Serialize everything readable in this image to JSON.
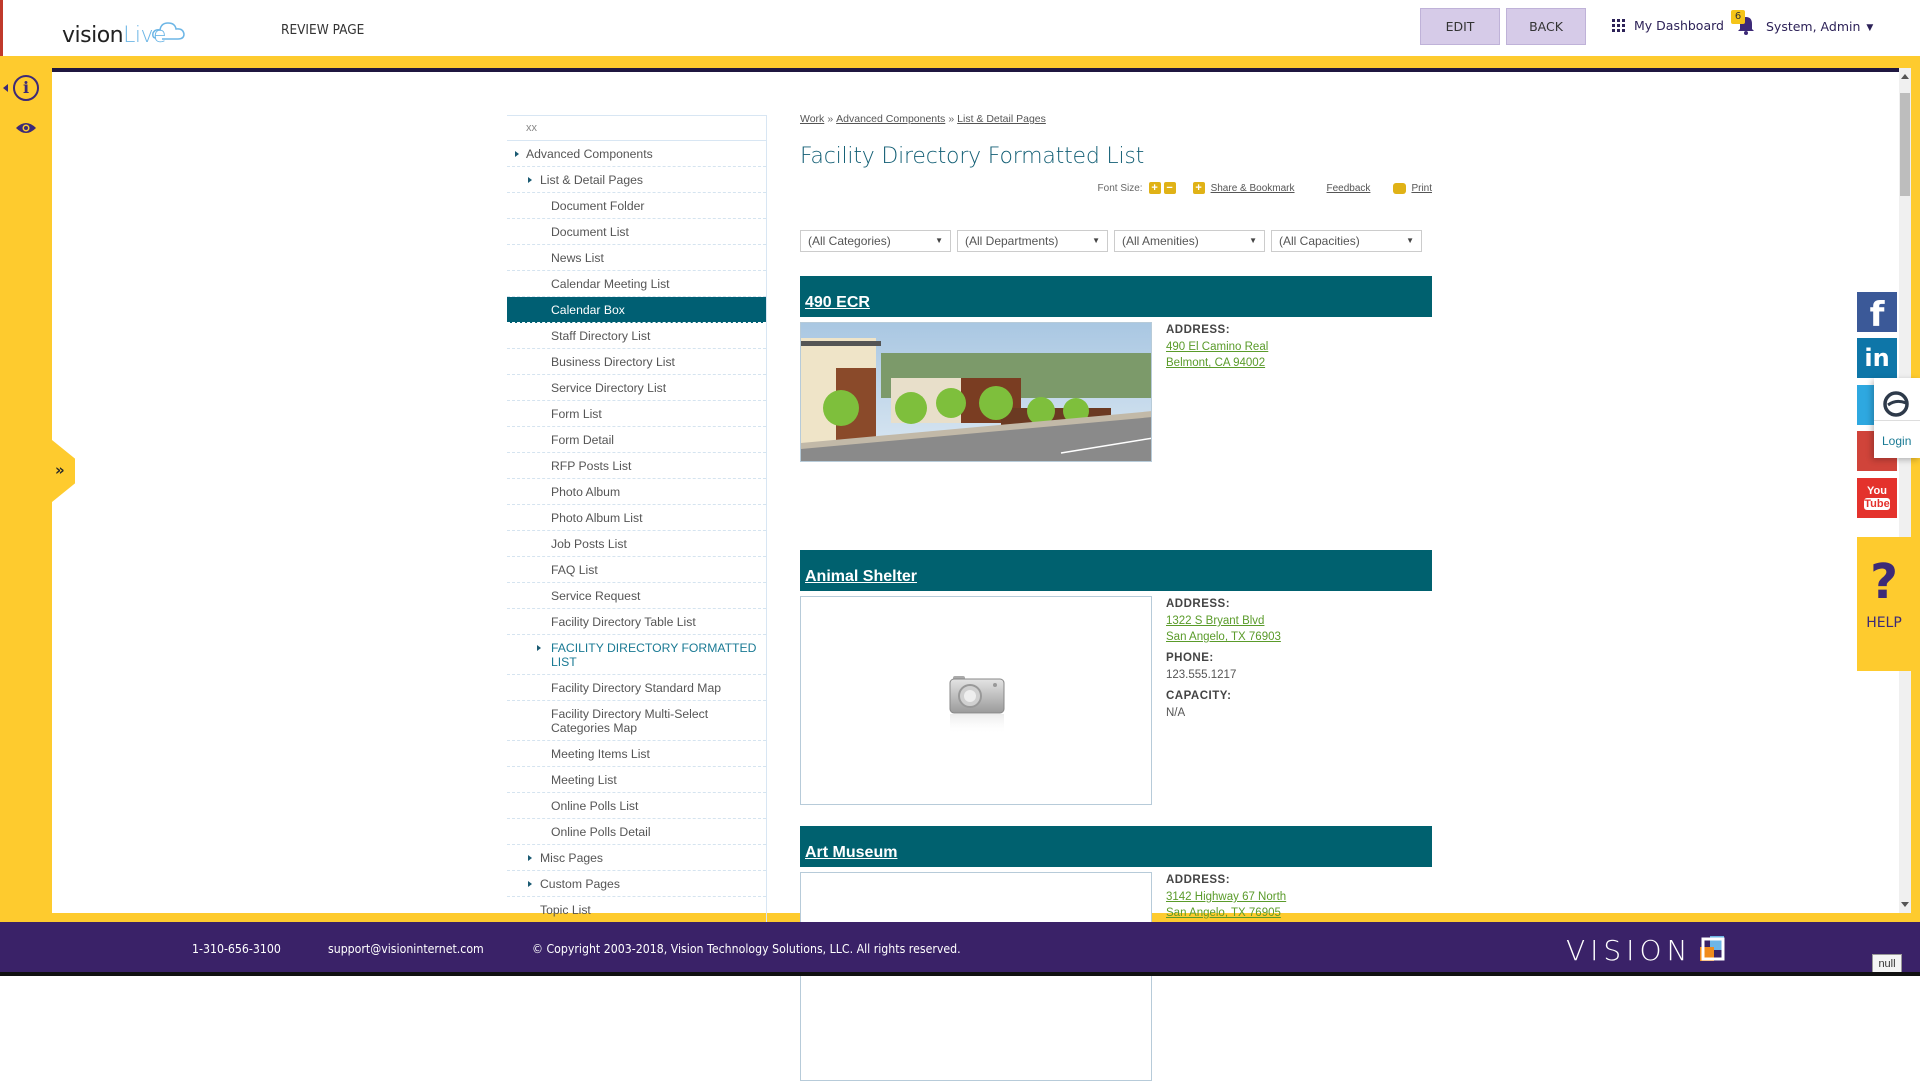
{
  "header": {
    "logo_part1": "vision",
    "logo_part2": "Live",
    "page_label": "REVIEW PAGE",
    "edit_label": "EDIT",
    "back_label": "BACK",
    "dashboard_label": "My Dashboard",
    "notification_count": "6",
    "user_label": "System, Admin"
  },
  "left_rail": {
    "icons": [
      "info-icon",
      "eye-icon"
    ],
    "expand_icon": "double-chevron-right-icon"
  },
  "nav": {
    "header_text": "xx",
    "items": [
      {
        "label": "Advanced Components",
        "level": 1,
        "has_children": true
      },
      {
        "label": "List & Detail Pages",
        "level": 2,
        "has_children": true
      },
      {
        "label": "Document Folder",
        "level": 3
      },
      {
        "label": "Document List",
        "level": 3
      },
      {
        "label": "News List",
        "level": 3
      },
      {
        "label": "Calendar Meeting List",
        "level": 3
      },
      {
        "label": "Calendar Box",
        "level": 3,
        "active": true
      },
      {
        "label": "Staff Directory List",
        "level": 3
      },
      {
        "label": "Business Directory List",
        "level": 3
      },
      {
        "label": "Service Directory List",
        "level": 3
      },
      {
        "label": "Form List",
        "level": 3
      },
      {
        "label": "Form Detail",
        "level": 3
      },
      {
        "label": "RFP Posts List",
        "level": 3
      },
      {
        "label": "Photo Album",
        "level": 3
      },
      {
        "label": "Photo Album List",
        "level": 3
      },
      {
        "label": "Job Posts List",
        "level": 3
      },
      {
        "label": "FAQ List",
        "level": 3
      },
      {
        "label": "Service Request",
        "level": 3
      },
      {
        "label": "Facility Directory Table List",
        "level": 3
      },
      {
        "label": "Facility Directory Formatted List",
        "level": 3,
        "has_children": true,
        "current": true
      },
      {
        "label": "Facility Directory Standard Map",
        "level": 3
      },
      {
        "label": "Facility Directory Multi-Select Categories Map",
        "level": 3
      },
      {
        "label": "Meeting Items List",
        "level": 3
      },
      {
        "label": "Meeting List",
        "level": 3
      },
      {
        "label": "Online Polls List",
        "level": 3
      },
      {
        "label": "Online Polls Detail",
        "level": 3
      },
      {
        "label": "Misc Pages",
        "level": 2,
        "has_children": true
      },
      {
        "label": "Custom Pages",
        "level": 2,
        "has_children": true
      },
      {
        "label": "Topic List",
        "level": 2
      }
    ]
  },
  "main": {
    "breadcrumb": [
      "Work",
      "Advanced Components",
      "List & Detail Pages"
    ],
    "breadcrumb_sep": "»",
    "title": "Facility Directory Formatted List",
    "tools": {
      "font_size_label": "Font Size:",
      "increase": "+",
      "decrease": "−",
      "share_label": "Share & Bookmark",
      "feedback_label": "Feedback",
      "print_label": "Print"
    },
    "filters": [
      {
        "value": "(All Categories)"
      },
      {
        "value": "(All Departments)"
      },
      {
        "value": "(All Amenities)"
      },
      {
        "value": "(All Capacities)"
      }
    ],
    "facilities": [
      {
        "name": "490 ECR",
        "image": "building-photo",
        "address_label": "ADDRESS:",
        "address_line1": "490 El Camino Real",
        "address_line2": "Belmont, CA 94002"
      },
      {
        "name": "Animal Shelter",
        "image": "camera-placeholder",
        "address_label": "ADDRESS:",
        "address_line1": "1322 S Bryant Blvd",
        "address_line2": "San Angelo, TX 76903",
        "phone_label": "PHONE:",
        "phone": "123.555.1217",
        "capacity_label": "CAPACITY:",
        "capacity": "N/A"
      },
      {
        "name": "Art Museum",
        "image": "camera-placeholder",
        "address_label": "ADDRESS:",
        "address_line1": "3142 Highway 67 North",
        "address_line2": "San Angelo, TX 76905"
      }
    ]
  },
  "right_rail": {
    "social": [
      {
        "name": "facebook",
        "glyph": "f"
      },
      {
        "name": "linkedin",
        "glyph": "in"
      },
      {
        "name": "twitter",
        "glyph": ""
      },
      {
        "name": "google-plus",
        "glyph": ""
      },
      {
        "name": "youtube",
        "glyph_top": "You",
        "glyph_bottom": "Tube"
      }
    ],
    "login_label": "Login",
    "help_glyph": "?",
    "help_label": "HELP"
  },
  "footer": {
    "phone": "1-310-656-3100",
    "email": "support@visioninternet.com",
    "copyright": "© Copyright 2003-2018, Vision Technology Solutions, LLC. All rights reserved.",
    "brand": "VISION",
    "null_label": "null"
  },
  "colors": {
    "accent_yellow": "#fecb2e",
    "brand_purple": "#3a2268",
    "teal": "#00616f",
    "link_green": "#5a9b2a"
  }
}
